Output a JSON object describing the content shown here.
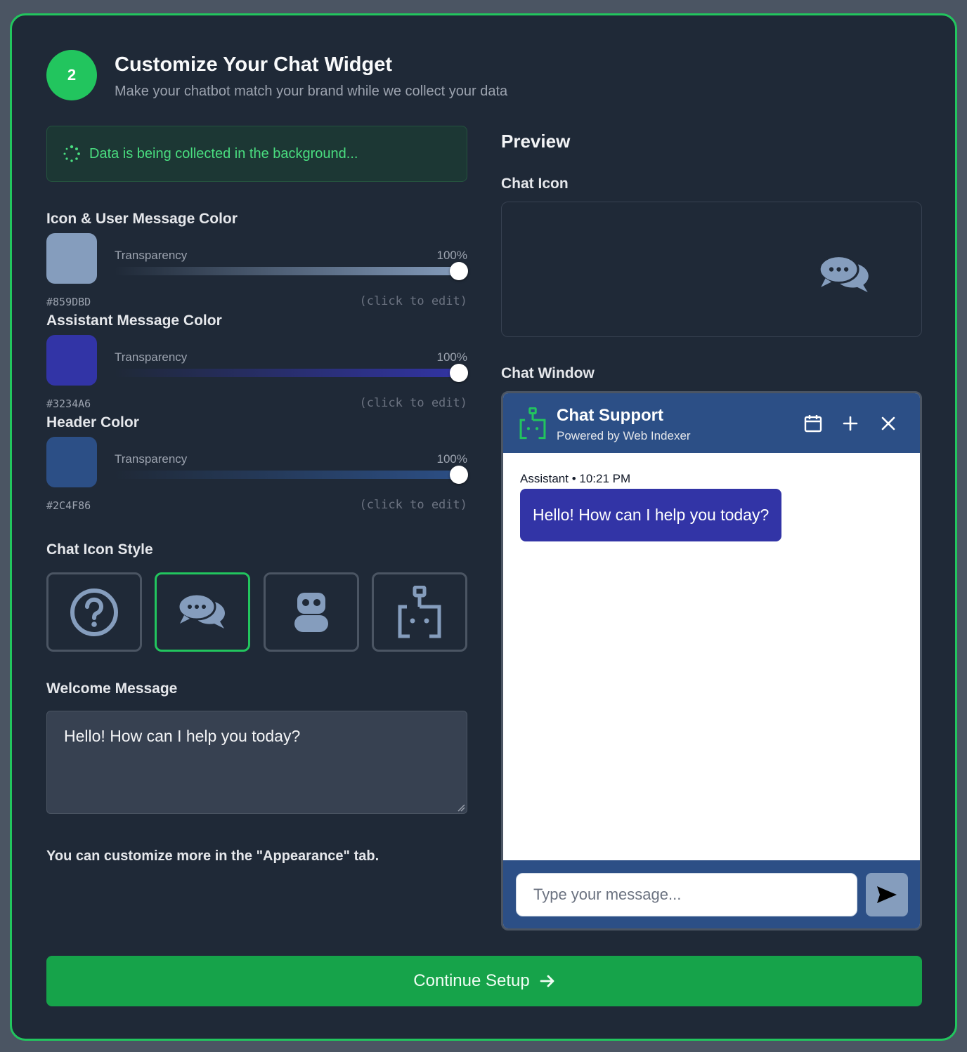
{
  "header": {
    "step_number": "2",
    "title": "Customize Your Chat Widget",
    "subtitle": "Make your chatbot match your brand while we collect your data"
  },
  "status": {
    "text": "Data is being collected in the background...",
    "icon": "spinner-icon"
  },
  "colors": [
    {
      "label": "Icon & User Message Color",
      "hex": "#859DBD",
      "swatch": "#859dbd",
      "transparency_label": "Transparency",
      "transparency_value": "100%",
      "transparency": 1.0,
      "edit_hint": "(click to edit)"
    },
    {
      "label": "Assistant Message Color",
      "hex": "#3234A6",
      "swatch": "#3234a6",
      "transparency_label": "Transparency",
      "transparency_value": "100%",
      "transparency": 1.0,
      "edit_hint": "(click to edit)"
    },
    {
      "label": "Header Color",
      "hex": "#2C4F86",
      "swatch": "#2c4f86",
      "transparency_label": "Transparency",
      "transparency_value": "100%",
      "transparency": 1.0,
      "edit_hint": "(click to edit)"
    }
  ],
  "icon_style": {
    "label": "Chat Icon Style",
    "options": [
      "question-circle-icon",
      "chat-bubbles-icon",
      "robot-icon",
      "robot-outline-icon"
    ],
    "selected": "chat-bubbles-icon"
  },
  "welcome": {
    "label": "Welcome Message",
    "value": "Hello! How can I help you today?"
  },
  "hint": "You can customize more in the \"Appearance\" tab.",
  "preview": {
    "title": "Preview",
    "chat_icon_label": "Chat Icon",
    "chat_window_label": "Chat Window",
    "window": {
      "title": "Chat Support",
      "subtitle": "Powered by Web Indexer",
      "message_meta": "Assistant • 10:21 PM",
      "message": "Hello! How can I help you today?",
      "input_placeholder": "Type your message...",
      "header_icons": [
        "calendar-icon",
        "plus-icon",
        "close-icon"
      ]
    }
  },
  "continue_label": "Continue Setup",
  "accent": "#22c55e"
}
